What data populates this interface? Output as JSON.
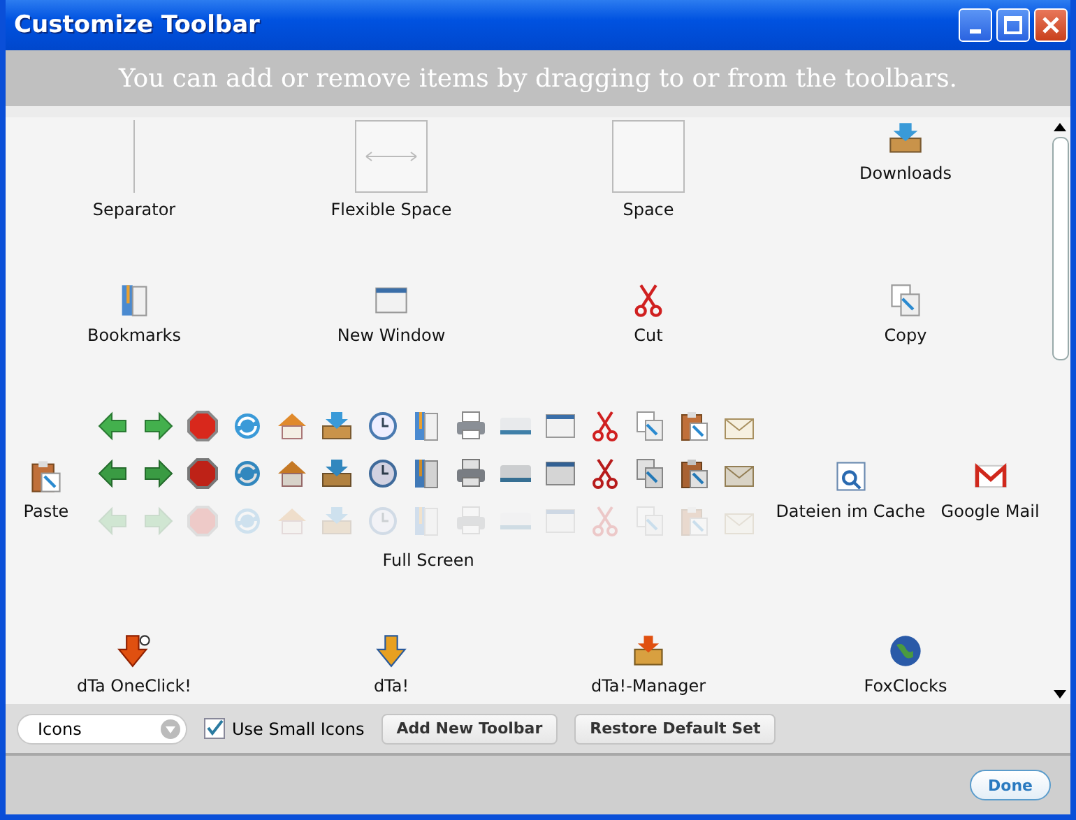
{
  "window": {
    "title": "Customize Toolbar"
  },
  "instructions": "You can add or remove items by dragging to or from the toolbars.",
  "rows": [
    [
      {
        "kind": "separator",
        "label": "Separator"
      },
      {
        "kind": "flexible-space",
        "label": "Flexible Space"
      },
      {
        "kind": "space",
        "label": "Space"
      },
      {
        "kind": "button",
        "label": "Downloads"
      }
    ],
    [
      {
        "kind": "button",
        "label": "Bookmarks"
      },
      {
        "kind": "button",
        "label": "New Window"
      },
      {
        "kind": "button",
        "label": "Cut"
      },
      {
        "kind": "button",
        "label": "Copy"
      }
    ],
    [
      {
        "kind": "button",
        "label": "Paste"
      },
      {
        "kind": "fullscreen",
        "label": "Full Screen"
      },
      {
        "kind": "button",
        "label": "Dateien im Cache"
      },
      {
        "kind": "button",
        "label": "Google Mail"
      }
    ],
    [
      {
        "kind": "button",
        "label": "dTa OneClick!"
      },
      {
        "kind": "button",
        "label": "dTa!"
      },
      {
        "kind": "button",
        "label": "dTa!-Manager"
      },
      {
        "kind": "button",
        "label": "FoxClocks"
      }
    ]
  ],
  "mode_select": {
    "value": "Icons"
  },
  "small_icons": {
    "label": "Use Small Icons",
    "checked": true
  },
  "buttons": [
    "Add New Toolbar",
    "Restore Default Set"
  ],
  "done_button": "Done"
}
